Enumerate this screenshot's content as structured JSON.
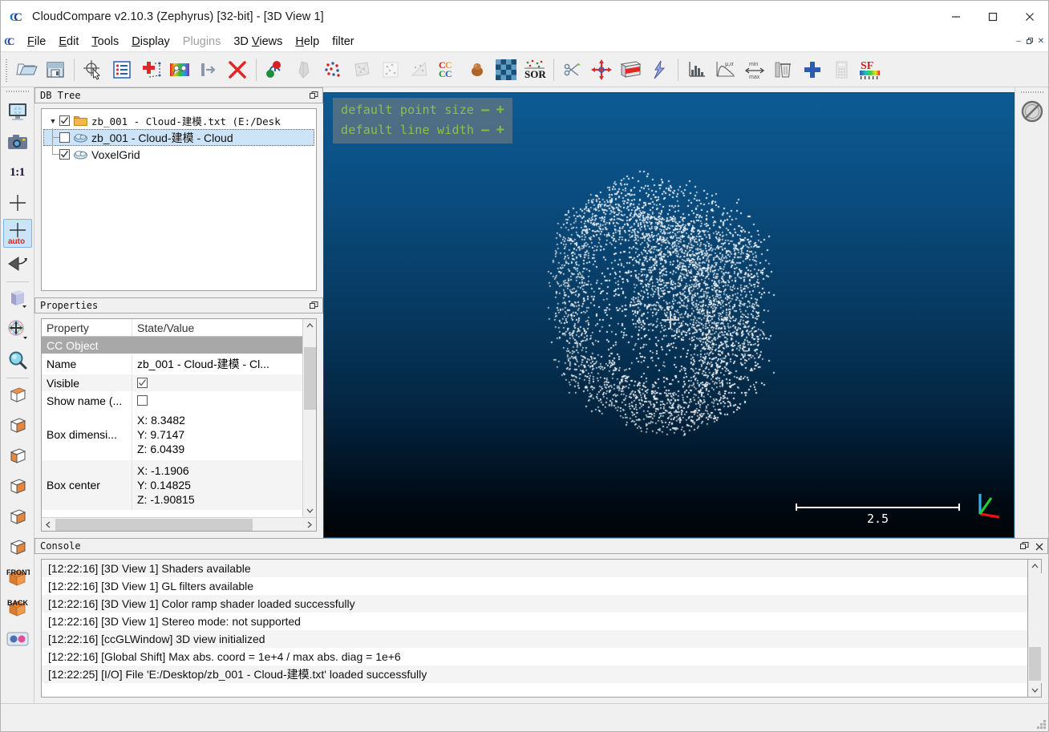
{
  "window": {
    "title": "CloudCompare v2.10.3 (Zephyrus) [32-bit] - [3D View 1]",
    "app_icon": "cloudcompare-icon",
    "minimize": "─",
    "maximize": "□",
    "close": "✕"
  },
  "menubar": {
    "mdi_icon": "cloudcompare-small-icon",
    "items": [
      {
        "label": "File",
        "mnemonic": "F",
        "disabled": false
      },
      {
        "label": "Edit",
        "mnemonic": "E",
        "disabled": false
      },
      {
        "label": "Tools",
        "mnemonic": "T",
        "disabled": false
      },
      {
        "label": "Display",
        "mnemonic": "D",
        "disabled": false
      },
      {
        "label": "Plugins",
        "mnemonic": "",
        "disabled": true
      },
      {
        "label": "3D Views",
        "mnemonic": "V",
        "disabled": false
      },
      {
        "label": "Help",
        "mnemonic": "H",
        "disabled": false
      },
      {
        "label": "filter",
        "mnemonic": "",
        "disabled": false
      }
    ],
    "mdi_buttons": [
      {
        "name": "mdi-minimize-button",
        "glyph": "–"
      },
      {
        "name": "mdi-restore-button",
        "glyph": "❐"
      },
      {
        "name": "mdi-close-button",
        "glyph": "✕"
      }
    ]
  },
  "main_toolbar": {
    "buttons": [
      {
        "name": "open-file-button",
        "icon": "open-folder-icon",
        "disabled": false
      },
      {
        "name": "save-file-button",
        "icon": "floppy-save-icon",
        "disabled": false
      },
      {
        "sep": true
      },
      {
        "name": "pick-point-button",
        "icon": "point-picking-icon",
        "disabled": false
      },
      {
        "name": "properties-button",
        "icon": "list-properties-icon",
        "disabled": false
      },
      {
        "name": "point-list-picking-button",
        "icon": "red-cross-picking-icon",
        "disabled": false
      },
      {
        "name": "color-scale-button",
        "icon": "rainbow-colors-icon",
        "disabled": false
      },
      {
        "name": "segment-in-button",
        "icon": "enter-arrow-icon",
        "disabled": false
      },
      {
        "name": "delete-button",
        "icon": "red-x-delete-icon",
        "disabled": false
      },
      {
        "sep": true
      },
      {
        "name": "clone-button",
        "icon": "green-red-balls-icon",
        "disabled": false
      },
      {
        "name": "merge-button",
        "icon": "gray-shape-icon",
        "disabled": true
      },
      {
        "name": "registration-button",
        "icon": "red-blue-dots-icon",
        "disabled": false
      },
      {
        "name": "mesh-button",
        "icon": "mesh-triangle-icon",
        "disabled": true
      },
      {
        "name": "scatter-tool-button",
        "icon": "scatter-dots-icon",
        "disabled": true
      },
      {
        "name": "cloud-mesh-dist-button",
        "icon": "cloud-mesh-distance-icon",
        "disabled": true
      },
      {
        "name": "cloud-cloud-dist-button",
        "icon": "cc-letters-icon",
        "disabled": false
      },
      {
        "name": "normals-button",
        "icon": "brown-blob-icon",
        "disabled": false
      },
      {
        "name": "checker-button",
        "icon": "checkerboard-icon",
        "disabled": false
      },
      {
        "name": "sor-filter-button",
        "icon": "sor-icon",
        "disabled": false
      },
      {
        "sep": true
      },
      {
        "name": "scissors-button",
        "icon": "scissors-icon",
        "disabled": false
      },
      {
        "name": "translate-rotate-button",
        "icon": "move-arrows-icon",
        "disabled": false
      },
      {
        "name": "section-button",
        "icon": "red-slice-box-icon",
        "disabled": false
      },
      {
        "name": "lightning-button",
        "icon": "lightning-icon",
        "disabled": false
      },
      {
        "sep": true
      },
      {
        "name": "histogram-button",
        "icon": "histogram-icon",
        "disabled": false
      },
      {
        "name": "gaussian-filter-button",
        "icon": "mu-sigma-curve-icon",
        "disabled": false
      },
      {
        "name": "min-max-button",
        "icon": "min-max-icon",
        "disabled": false
      },
      {
        "name": "trash-sf-button",
        "icon": "trash-icon",
        "disabled": false
      },
      {
        "name": "add-sf-button",
        "icon": "blue-plus-icon",
        "disabled": false
      },
      {
        "name": "calculator-button",
        "icon": "calculator-icon",
        "disabled": true
      },
      {
        "name": "sf-gradient-button",
        "icon": "sf-gradient-icon",
        "disabled": false
      }
    ]
  },
  "left_toolbar": {
    "buttons": [
      {
        "name": "view-settings-button",
        "icon": "monitor-gear-icon",
        "checked": false
      },
      {
        "name": "snapshot-button",
        "icon": "camera-icon",
        "checked": false
      },
      {
        "name": "zoom-one-to-one-button",
        "icon": "one-to-one-icon",
        "label": "1:1",
        "checked": false
      },
      {
        "name": "set-pivot-button",
        "icon": "crosshair-icon",
        "checked": false
      },
      {
        "name": "auto-pivot-button",
        "icon": "crosshair-auto-icon",
        "label": "auto",
        "checked": true
      },
      {
        "name": "camera-projection-button",
        "icon": "perspective-arrow-icon",
        "checked": false
      },
      {
        "sep": true
      },
      {
        "name": "default-colors-button",
        "icon": "purple-cube-icon",
        "checked": false
      },
      {
        "name": "transform-gizmo-button",
        "icon": "move-gizmo-icon",
        "checked": false
      },
      {
        "name": "zoom-global-button",
        "icon": "magnifier-icon",
        "checked": false
      },
      {
        "sep": true
      },
      {
        "name": "view-top-button",
        "icon": "cube-top-icon",
        "checked": false
      },
      {
        "name": "view-bottom-button",
        "icon": "cube-bottom-icon",
        "checked": false
      },
      {
        "name": "view-front-button",
        "icon": "cube-front-icon",
        "checked": false
      },
      {
        "name": "view-back-button",
        "icon": "cube-back-icon",
        "checked": false
      },
      {
        "name": "view-left-button",
        "icon": "cube-left-icon",
        "checked": false
      },
      {
        "name": "view-right-button",
        "icon": "cube-right-icon",
        "checked": false
      },
      {
        "name": "view-front-label-button",
        "icon": "cube-front-label-icon",
        "label": "FRONT",
        "checked": false
      },
      {
        "name": "view-back-label-button",
        "icon": "cube-back-label-icon",
        "label": "BACK",
        "checked": false
      },
      {
        "name": "stereo-mode-button",
        "icon": "anaglyph-dots-icon",
        "checked": false
      }
    ]
  },
  "right_toolbar": {
    "buttons": [
      {
        "name": "no-filter-button",
        "icon": "forbidden-circle-icon"
      }
    ]
  },
  "db_tree": {
    "title": "DB Tree",
    "float_icon": "undock-icon",
    "nodes": [
      {
        "name": "tree-item-file-root",
        "label": "zb_001 - Cloud-建模.txt  (E:/Desk",
        "icon": "folder-icon",
        "checked": true,
        "expanded": true,
        "selected": false,
        "depth": 0,
        "mono": true
      },
      {
        "name": "tree-item-cloud",
        "label": "zb_001 - Cloud-建模 - Cloud",
        "icon": "cloud-icon",
        "checked": false,
        "expanded": null,
        "selected": true,
        "depth": 1,
        "mono": false
      },
      {
        "name": "tree-item-voxelgrid",
        "label": "VoxelGrid",
        "icon": "cloud-icon",
        "checked": true,
        "expanded": null,
        "selected": false,
        "depth": 1,
        "mono": false
      }
    ]
  },
  "properties": {
    "title": "Properties",
    "float_icon": "undock-icon",
    "columns": [
      "Property",
      "State/Value"
    ],
    "rows": [
      {
        "name": "prop-section-cc-object",
        "type": "section",
        "label": "CC Object",
        "value": ""
      },
      {
        "name": "prop-row-name",
        "type": "text",
        "label": "Name",
        "value": "zb_001 - Cloud-建模 - Cl..."
      },
      {
        "name": "prop-row-visible",
        "type": "checkbox",
        "label": "Visible",
        "checked": true
      },
      {
        "name": "prop-row-show-name",
        "type": "checkbox",
        "label": "Show name (...",
        "checked": false
      },
      {
        "name": "prop-row-box-dimensions",
        "type": "xyz",
        "label": "Box dimensi...",
        "x": "X: 8.3482",
        "y": "Y: 9.7147",
        "z": "Z: 6.0439"
      },
      {
        "name": "prop-row-box-center",
        "type": "xyz",
        "label": "Box center",
        "x": "X: -1.1906",
        "y": "Y: 0.14825",
        "z": "Z: -1.90815"
      }
    ]
  },
  "view3d": {
    "overlay": [
      {
        "name": "point-size-control",
        "label": "default point size",
        "minus": "—",
        "plus": "+"
      },
      {
        "name": "line-width-control",
        "label": "default line width",
        "minus": "—",
        "plus": "+"
      }
    ],
    "scale_bar_label": "2.5",
    "axis_gizmo": {
      "name": "axis-trihedron-icon",
      "x_color": "#ee1111",
      "y_color": "#22cc33",
      "z_color": "#2eb3e6"
    },
    "background_top": "#0d5b94",
    "background_bottom": "#000305",
    "point_color": "#ffffff"
  },
  "console": {
    "title": "Console",
    "float_icon": "undock-icon",
    "close_icon": "close-icon",
    "messages": [
      "[12:22:16] [3D View 1] Shaders available",
      "[12:22:16] [3D View 1] GL filters available",
      "[12:22:16] [3D View 1] Color ramp shader loaded successfully",
      "[12:22:16] [3D View 1] Stereo mode: not supported",
      "[12:22:16] [ccGLWindow] 3D view initialized",
      "[12:22:16] [Global Shift] Max abs. coord = 1e+4 / max abs. diag = 1e+6",
      "[12:22:25] [I/O] File 'E:/Desktop/zb_001 - Cloud-建模.txt' loaded successfully"
    ]
  },
  "statusbar": {
    "text": "",
    "grip": "resize-grip-icon"
  }
}
